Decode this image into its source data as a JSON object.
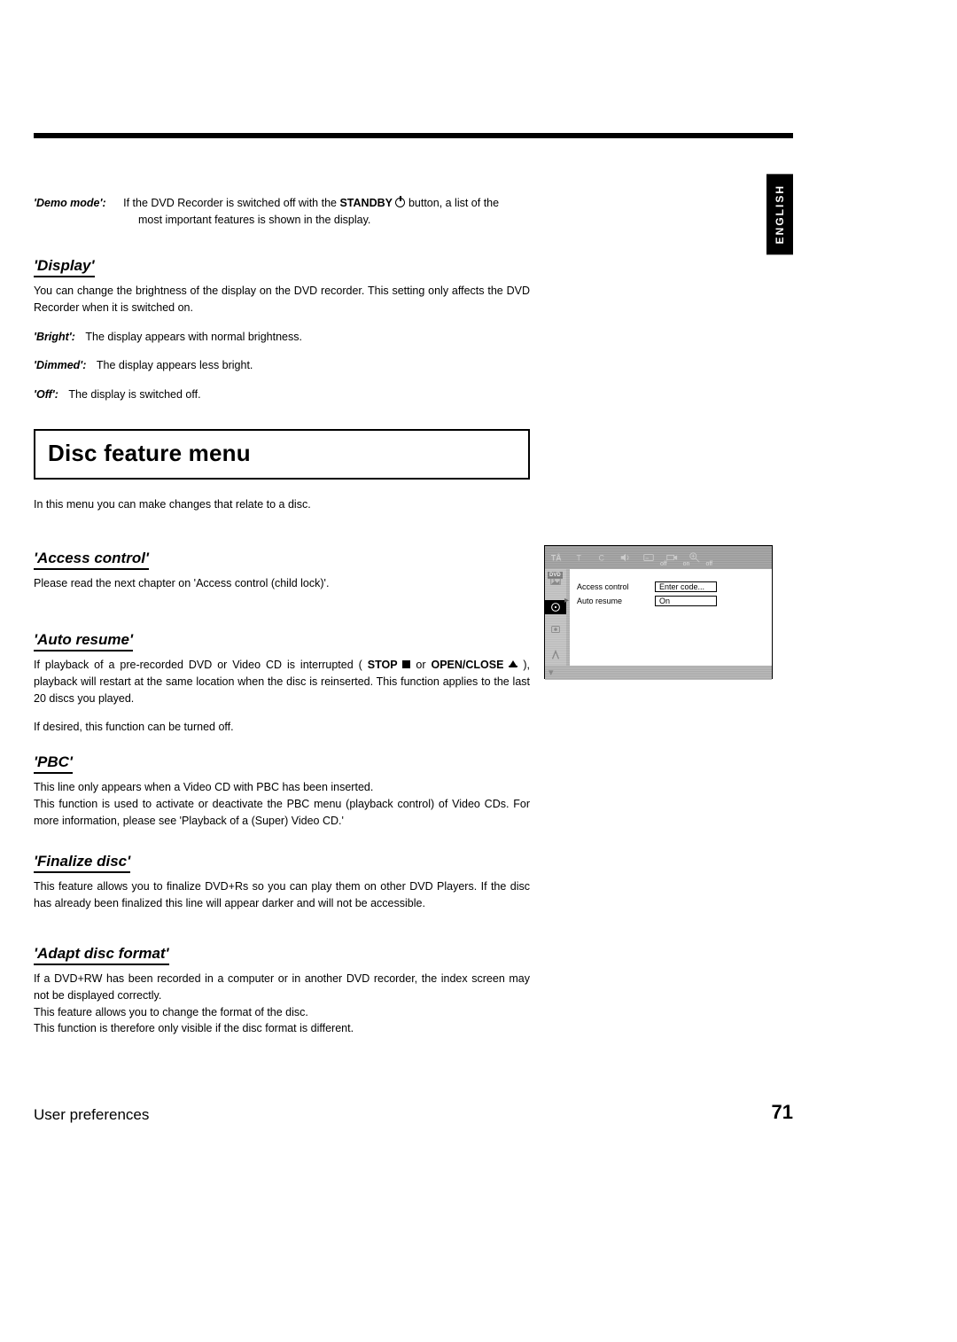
{
  "language_tab": "ENGLISH",
  "demo_mode": {
    "label": "'Demo mode':",
    "text_1": "If the DVD Recorder is switched off with the ",
    "standby_label": "STANDBY",
    "text_2": " button, a list of the",
    "text_cont": "most important features is shown in the display."
  },
  "display": {
    "heading": "'Display'",
    "intro": "You can change the brightness of the display on the DVD recorder. This setting only affects the DVD Recorder when it is switched on.",
    "bright_label": "'Bright':",
    "bright_text": "The display appears with normal brightness.",
    "dimmed_label": "'Dimmed':",
    "dimmed_text": "The display appears less bright.",
    "off_label": "'Off':",
    "off_text": "The display is switched off."
  },
  "disc_menu_heading": "Disc feature menu",
  "disc_menu_intro": "In this menu you can make changes that relate to a disc.",
  "access": {
    "heading": "'Access control'",
    "text": "Please read the next chapter on 'Access control (child lock)'."
  },
  "auto_resume": {
    "heading": "'Auto resume'",
    "p1a": "If playback of a pre-recorded DVD or Video CD is interrupted ( ",
    "stop_label": "STOP",
    "p1b": " or ",
    "open_label": "OPEN/CLOSE",
    "p1c": " ), playback will restart at the same location when the disc is reinserted. This function applies to the last 20 discs you played.",
    "p2": "If desired, this function can be turned off."
  },
  "pbc": {
    "heading": "'PBC'",
    "l1": "This line only appears when a Video CD with PBC has been inserted.",
    "l2": "This function is used to activate or deactivate the PBC menu (playback control) of Video CDs. For more information, please see 'Playback of a (Super) Video CD.'"
  },
  "finalize": {
    "heading": "'Finalize disc'",
    "text": "This feature allows you to finalize DVD+Rs so you can play them on other DVD Players. If the disc has already been finalized this line will appear darker and will not be accessible."
  },
  "adapt": {
    "heading": "'Adapt disc format'",
    "l1": "If a DVD+RW has been recorded in a computer or in another DVD recorder, the index screen may not be displayed correctly.",
    "l2": "This feature allows you to change the format of the disc.",
    "l3": "This function is therefore only visible if the disc format is different."
  },
  "osd": {
    "dvd_label": "DVD",
    "top_labels": {
      "off": "off",
      "on": "on",
      "off2": "off"
    },
    "row1_label": "Access control",
    "row1_value": "Enter code...",
    "row2_label": "Auto resume",
    "row2_value": "On"
  },
  "footer": {
    "left": "User preferences",
    "right": "71"
  }
}
